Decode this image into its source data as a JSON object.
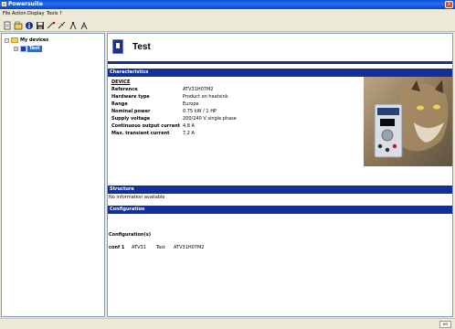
{
  "window": {
    "title": "Powersuite",
    "close_glyph": "x"
  },
  "menu": {
    "items": [
      "File",
      "Action",
      "Display",
      "Tools",
      "?"
    ]
  },
  "toolbar": {
    "buttons": [
      "new-icon",
      "open-icon",
      "info-icon",
      "save-icon",
      "connect-icon",
      "disconnect-icon",
      "run-icon",
      "stop-icon"
    ]
  },
  "tree": {
    "root_label": "My devices",
    "root_expander": "-",
    "child_expander": "+",
    "child_label": "Test"
  },
  "device": {
    "title": "Test"
  },
  "sections": {
    "characteristics": "Characteristics",
    "structure": "Structure",
    "configuration": "Configuration"
  },
  "characteristics": {
    "heading": "DEVICE",
    "rows": [
      {
        "label": "Reference",
        "value": "ATV31H07M2"
      },
      {
        "label": "Hardware type",
        "value": "Product on heatsink"
      },
      {
        "label": "Range",
        "value": "Europe"
      },
      {
        "label": "Nominal power",
        "value": "0.75 kW / 1 HP"
      },
      {
        "label": "Supply voltage",
        "value": "200/240 V single phase"
      },
      {
        "label": "Continuous output current",
        "value": "4,8 A"
      },
      {
        "label": "Max. transient current",
        "value": "7,2 A"
      }
    ]
  },
  "structure": {
    "text": "No information available"
  },
  "configuration": {
    "heading": "Configuration(s)",
    "entries": [
      {
        "name": "conf 1",
        "range": "ATV31",
        "label": "Test",
        "reference": "ATV31H07M2"
      }
    ]
  },
  "status": {
    "language": "en"
  },
  "colors": {
    "titlebar": "#0a4fd8",
    "section_bar": "#12309c",
    "selection": "#316ac5"
  }
}
